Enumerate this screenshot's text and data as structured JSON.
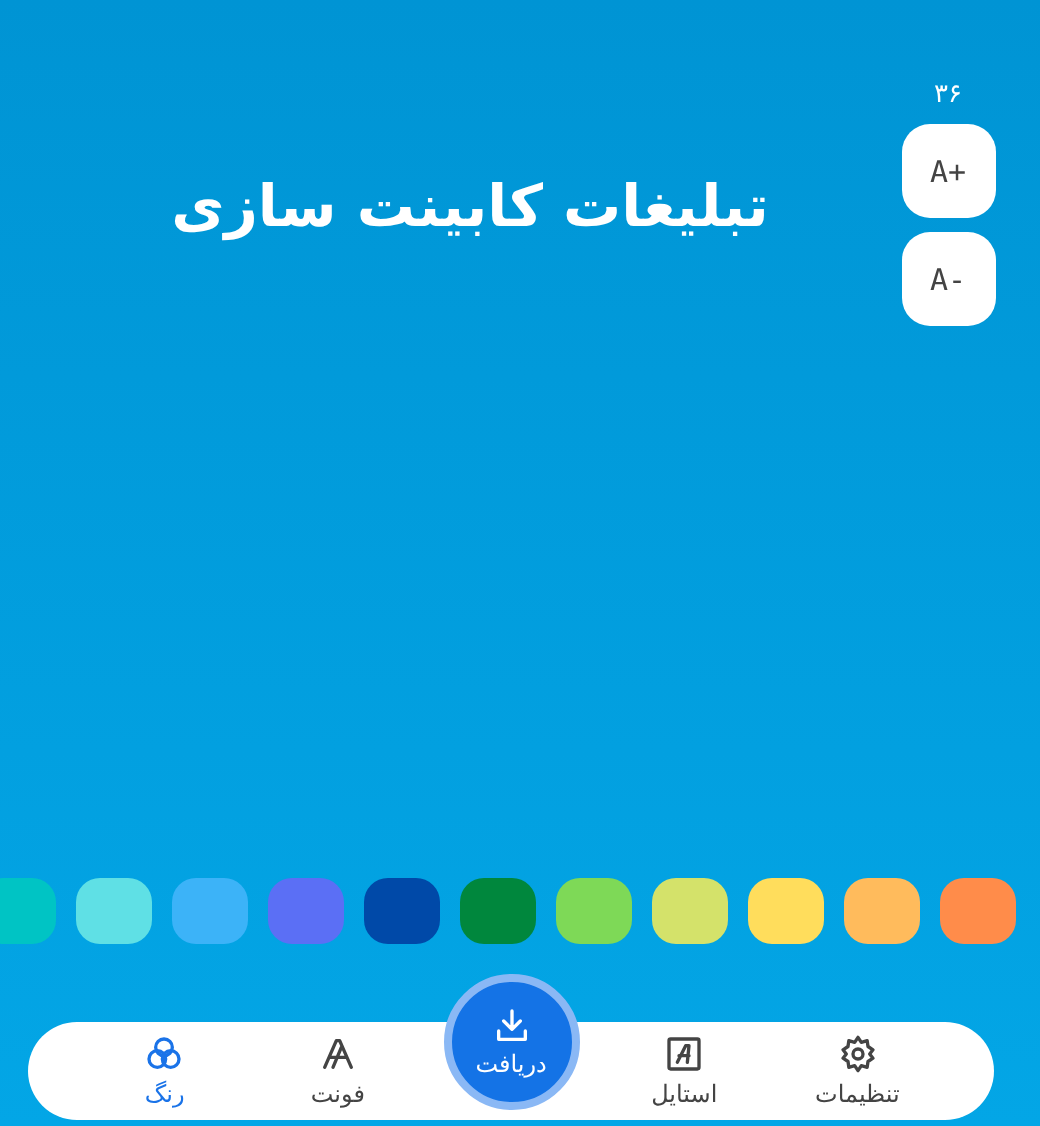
{
  "title": "تبلیغات کابینت سازی",
  "font_size": {
    "value": "۳۶",
    "buttons": [
      "A+",
      "A-"
    ]
  },
  "swatches": [
    {
      "color": "#ff8c4a"
    },
    {
      "color": "#ffbb5c"
    },
    {
      "color": "#ffdd5c"
    },
    {
      "color": "#d4e26a"
    },
    {
      "color": "#7ed957"
    },
    {
      "color": "#00873d"
    },
    {
      "color": "#0049a8"
    },
    {
      "color": "#5b6ff5"
    },
    {
      "color": "#3cb3f8"
    },
    {
      "color": "#5fe0e5"
    },
    {
      "color": "#00c4c4"
    }
  ],
  "nav": [
    {
      "label": "تنظیمات",
      "kind": "settings",
      "selected": false
    },
    {
      "label": "استایل",
      "kind": "style",
      "selected": false
    },
    {
      "label": "دریافت",
      "kind": "download",
      "selected": false
    },
    {
      "label": "فونت",
      "kind": "font",
      "selected": false
    },
    {
      "label": "رنگ",
      "kind": "color",
      "selected": true
    }
  ]
}
